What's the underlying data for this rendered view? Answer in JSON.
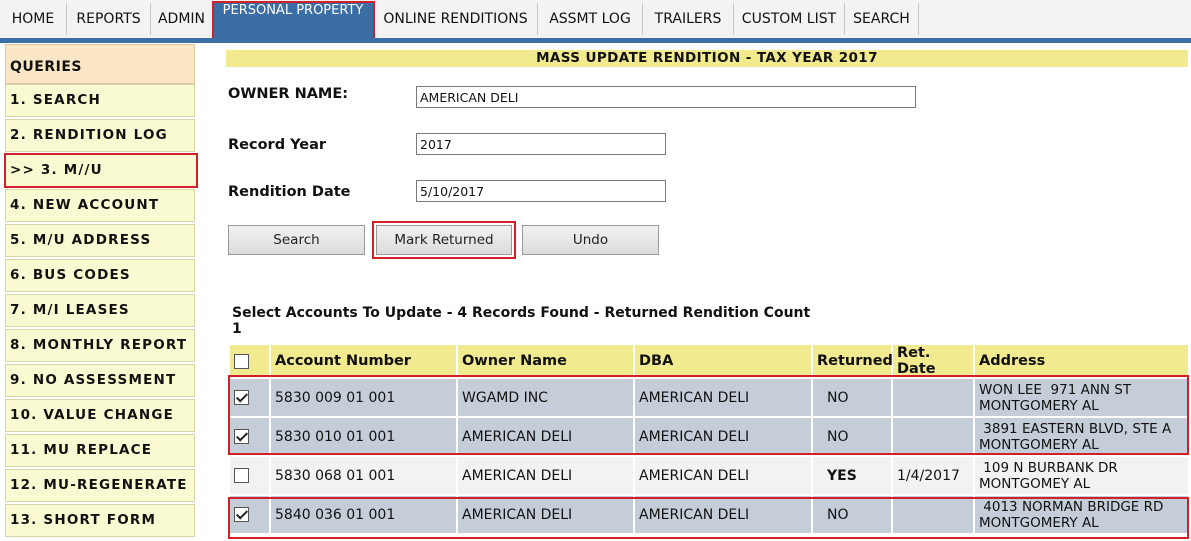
{
  "nav": {
    "tabs": [
      {
        "label": "HOME"
      },
      {
        "label": "REPORTS"
      },
      {
        "label": "ADMIN"
      },
      {
        "label": "PERSONAL PROPERTY"
      },
      {
        "label": "ONLINE RENDITIONS"
      },
      {
        "label": "ASSMT LOG"
      },
      {
        "label": "TRAILERS"
      },
      {
        "label": "CUSTOM LIST"
      },
      {
        "label": "SEARCH"
      }
    ],
    "active_tab": "PERSONAL PROPERTY",
    "accent_color": "#3a6ea5"
  },
  "sidebar": {
    "heading": "QUERIES",
    "items": [
      {
        "label": "1. SEARCH"
      },
      {
        "label": "2. RENDITION LOG"
      },
      {
        "label": ">> 3. M//U RENDITION"
      },
      {
        "label": "4. NEW ACCOUNT"
      },
      {
        "label": "5. M/U ADDRESS"
      },
      {
        "label": "6. BUS CODES"
      },
      {
        "label": "7. M/I LEASES"
      },
      {
        "label": "8. MONTHLY REPORT"
      },
      {
        "label": "9. NO ASSESSMENT"
      },
      {
        "label": "10. VALUE CHANGE"
      },
      {
        "label": "11. MU REPLACE"
      },
      {
        "label": "12. MU-REGENERATE"
      },
      {
        "label": "13. SHORT FORM"
      }
    ]
  },
  "main": {
    "title": "MASS UPDATE RENDITION - TAX YEAR 2017",
    "form": {
      "owner_label": "OWNER NAME:",
      "owner_value": "AMERICAN DELI",
      "year_label": "Record Year",
      "year_value": "2017",
      "date_label": "Rendition Date",
      "date_value": "5/10/2017"
    },
    "buttons": {
      "search": "Search",
      "mark_returned": "Mark Returned",
      "undo": "Undo"
    },
    "summary": "Select Accounts To Update -  4 Records Found - Returned Rendition Count 1",
    "table": {
      "headers": [
        "Account Number",
        "Owner Name",
        "DBA",
        "Returned",
        "Ret. Date",
        "Address"
      ],
      "rows": [
        {
          "checked": true,
          "account": "5830 009 01 001",
          "owner": "WGAMD INC",
          "dba": "AMERICAN DELI",
          "returned": "NO",
          "ret_date": "",
          "addr1": "WON LEE  971 ANN ST",
          "addr2": "MONTGOMERY AL"
        },
        {
          "checked": true,
          "account": "5830 010 01 001",
          "owner": "AMERICAN DELI",
          "dba": "AMERICAN DELI",
          "returned": "NO",
          "ret_date": "",
          "addr1": " 3891 EASTERN BLVD, STE A",
          "addr2": "MONTGOMERY AL"
        },
        {
          "checked": false,
          "account": "5830 068 01 001",
          "owner": "AMERICAN DELI",
          "dba": "AMERICAN DELI",
          "returned": "YES",
          "ret_date": "1/4/2017",
          "addr1": " 109 N BURBANK DR",
          "addr2": "MONTGOMEY AL"
        },
        {
          "checked": true,
          "account": "5840 036 01 001",
          "owner": "AMERICAN DELI",
          "dba": "AMERICAN DELI",
          "returned": "NO",
          "ret_date": "",
          "addr1": " 4013 NORMAN BRIDGE RD",
          "addr2": "MONTGOMERY AL"
        }
      ]
    }
  }
}
